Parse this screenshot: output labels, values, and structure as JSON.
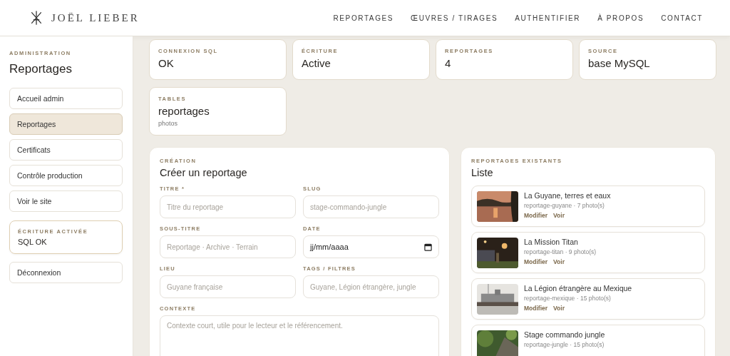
{
  "header": {
    "logo": "JOËL LIEBER",
    "nav": [
      {
        "label": "REPORTAGES"
      },
      {
        "label": "ŒUVRES / TIRAGES"
      },
      {
        "label": "AUTHENTIFIER"
      },
      {
        "label": "À PROPOS"
      },
      {
        "label": "CONTACT"
      }
    ]
  },
  "sidebar": {
    "eyebrow": "ADMINISTRATION",
    "title": "Reportages",
    "items": [
      {
        "label": "Accueil admin",
        "selected": false
      },
      {
        "label": "Reportages",
        "selected": true
      },
      {
        "label": "Certificats",
        "selected": false
      },
      {
        "label": "Contrôle production",
        "selected": false
      },
      {
        "label": "Voir le site",
        "selected": false
      }
    ],
    "status": {
      "label": "ÉCRITURE ACTIVÉE",
      "value": "SQL OK"
    },
    "logout": "Déconnexion"
  },
  "stats": [
    {
      "label": "CONNEXION SQL",
      "value": "OK"
    },
    {
      "label": "ÉCRITURE",
      "value": "Active"
    },
    {
      "label": "REPORTAGES",
      "value": "4"
    },
    {
      "label": "SOURCE",
      "value": "base MySQL"
    },
    {
      "label": "TABLES",
      "value": "reportages",
      "note": "photos"
    }
  ],
  "form": {
    "eyebrow": "CRÉATION",
    "title": "Créer un reportage",
    "fields": [
      {
        "label": "TITRE *",
        "placeholder": "Titre du reportage",
        "kind": "text"
      },
      {
        "label": "SLUG",
        "placeholder": "stage-commando-jungle",
        "kind": "text"
      },
      {
        "label": "SOUS-TITRE",
        "placeholder": "Reportage · Archive · Terrain",
        "kind": "text"
      },
      {
        "label": "DATE",
        "value": "jj/mm/aaaa",
        "kind": "date"
      },
      {
        "label": "LIEU",
        "placeholder": "Guyane française",
        "kind": "text"
      },
      {
        "label": "TAGS / FILTRES",
        "placeholder": "Guyane, Légion étrangère, jungle",
        "kind": "text"
      },
      {
        "label": "CONTEXTE",
        "placeholder": "Contexte court, utile pour le lecteur et le référencement.",
        "kind": "textarea"
      }
    ]
  },
  "list": {
    "eyebrow": "REPORTAGES EXISTANTS",
    "title": "Liste",
    "items": [
      {
        "title": "La Guyane, terres et eaux",
        "meta": "reportage-guyane · 7 photo(s)",
        "actions": [
          "Modifier",
          "Voir"
        ]
      },
      {
        "title": "La Mission Titan",
        "meta": "reportage-titan · 9 photo(s)",
        "actions": [
          "Modifier",
          "Voir"
        ]
      },
      {
        "title": "La Légion étrangère au Mexique",
        "meta": "reportage-mexique · 15 photo(s)",
        "actions": [
          "Modifier",
          "Voir"
        ]
      },
      {
        "title": "Stage commando jungle",
        "meta": "reportage-jungle · 15 photo(s)"
      }
    ]
  }
}
